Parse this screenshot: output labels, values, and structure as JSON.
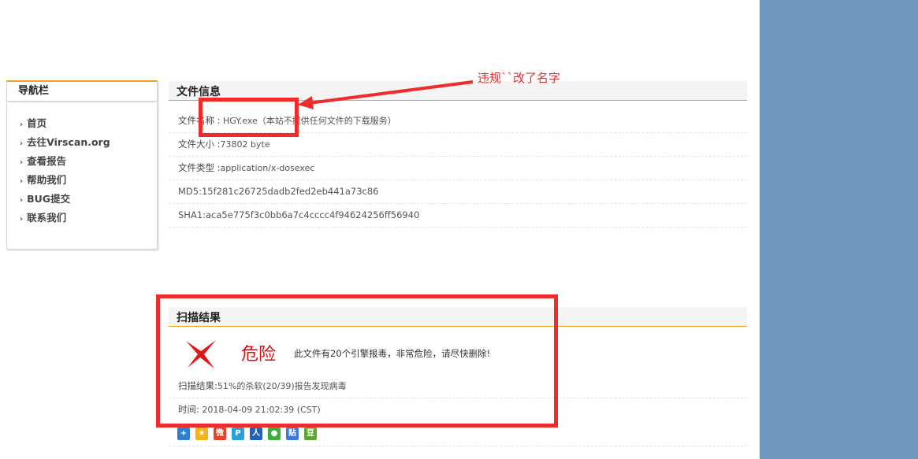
{
  "sidebar": {
    "title": "导航栏",
    "items": [
      {
        "label": "首页"
      },
      {
        "label": "去往Virscan.org"
      },
      {
        "label": "查看报告"
      },
      {
        "label": "帮助我们"
      },
      {
        "label": "BUG提交"
      },
      {
        "label": "联系我们"
      }
    ]
  },
  "file_info": {
    "title": "文件信息",
    "name_label": "文件名称 :",
    "name_value": "HGY.exe（本站不提供任何文件的下载服务）",
    "size_label": "文件大小 :",
    "size_value": "73802 byte",
    "type_label": "文件类型 :",
    "type_value": "application/x-dosexec",
    "md5": "MD5:15f281c26725dadb2fed2eb441a73c86",
    "sha1": "SHA1:aca5e775f3c0bb6a7c4cccc4f94624256ff56940"
  },
  "scan_result": {
    "title": "扫描结果",
    "danger_label": "危险",
    "danger_desc": "此文件有20个引擎报毒，非常危险，请尽快删除!",
    "result_label": "扫描结果:",
    "result_value": "51%的杀软(20/39)报告发现病毒",
    "time_label": "时间:",
    "time_value": "2018-04-09 21:02:39 (CST)"
  },
  "annotation": {
    "text": "违规``改了名字"
  },
  "share_icons": [
    {
      "name": "plus-share-icon",
      "glyph": "+",
      "color": "#2e7fd0"
    },
    {
      "name": "qzone-share-icon",
      "glyph": "★",
      "color": "#f2b41c"
    },
    {
      "name": "weibo-share-icon",
      "glyph": "微",
      "color": "#e6432a"
    },
    {
      "name": "tqq-share-icon",
      "glyph": "P",
      "color": "#2aa0d8"
    },
    {
      "name": "renren-share-icon",
      "glyph": "人",
      "color": "#1f62b8"
    },
    {
      "name": "wechat-share-icon",
      "glyph": "●",
      "color": "#3cae3c"
    },
    {
      "name": "tieba-share-icon",
      "glyph": "贴",
      "color": "#3d7ad8"
    },
    {
      "name": "douban-share-icon",
      "glyph": "豆",
      "color": "#5aa630"
    }
  ],
  "colors": {
    "accent": "#f0a020",
    "annotation_red": "#ef2b2b",
    "danger_red": "#d01010",
    "right_panel": "#7098bd"
  }
}
